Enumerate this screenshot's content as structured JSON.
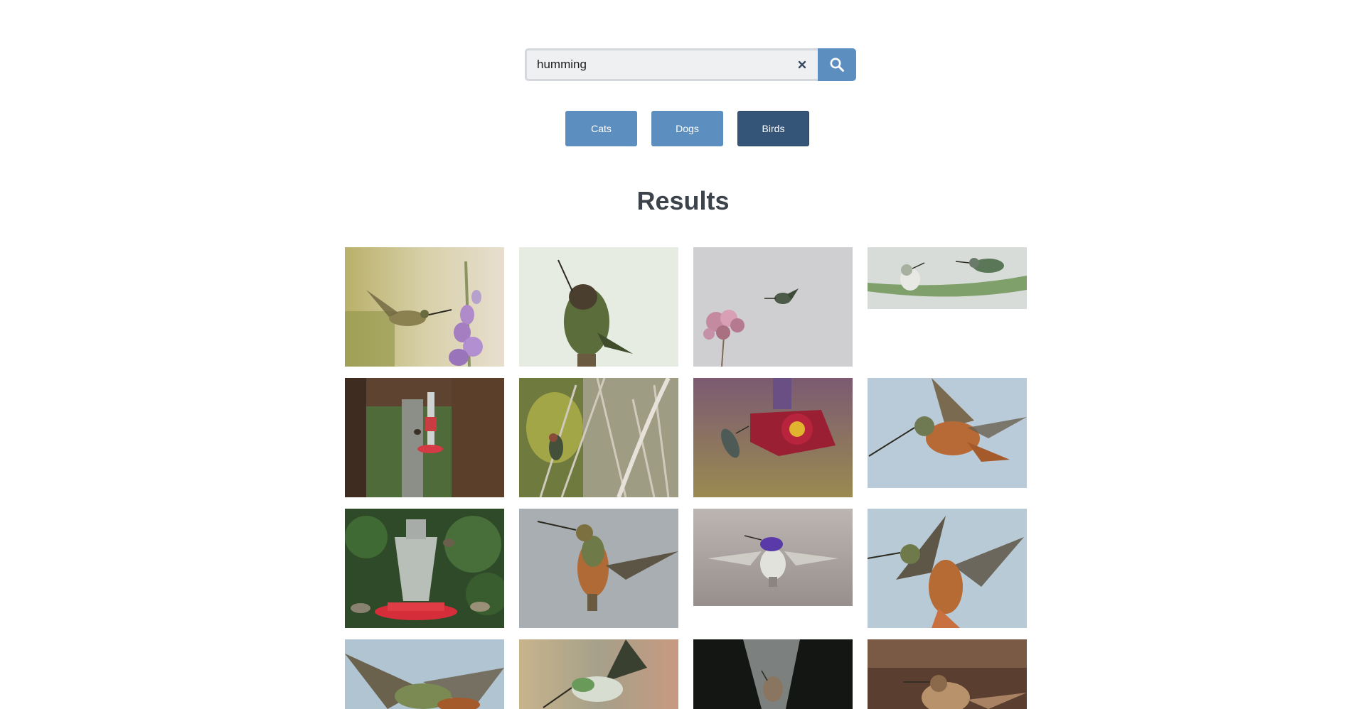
{
  "search": {
    "value": "humming",
    "placeholder": "",
    "clear_icon": "close-icon",
    "submit_icon": "search-icon"
  },
  "categories": [
    {
      "label": "Cats",
      "active": false
    },
    {
      "label": "Dogs",
      "active": false
    },
    {
      "label": "Birds",
      "active": true
    }
  ],
  "results": {
    "title": "Results",
    "images": [
      {
        "subject": "hummingbird-purple-flowers"
      },
      {
        "subject": "hummingbird-perched"
      },
      {
        "subject": "hummingbird-pink-flower"
      },
      {
        "subject": "two-hummingbirds-leaf"
      },
      {
        "subject": "hummingbird-feeder-porch"
      },
      {
        "subject": "hummingbird-branches"
      },
      {
        "subject": "hummingbird-red-feeder"
      },
      {
        "subject": "rufous-hummingbird-flight"
      },
      {
        "subject": "hummingbirds-bottle-feeder"
      },
      {
        "subject": "rufous-hummingbird-wings"
      },
      {
        "subject": "costas-hummingbird"
      },
      {
        "subject": "rufous-hummingbird-spread"
      },
      {
        "subject": "hummingbird-hovering"
      },
      {
        "subject": "hummingbird-green-flight"
      },
      {
        "subject": "hummingbird-glass-feeder"
      },
      {
        "subject": "hummingbird-brown-background"
      }
    ]
  },
  "colors": {
    "accent": "#5c8ebf",
    "accent_active": "#345578",
    "heading": "#3d434b"
  }
}
